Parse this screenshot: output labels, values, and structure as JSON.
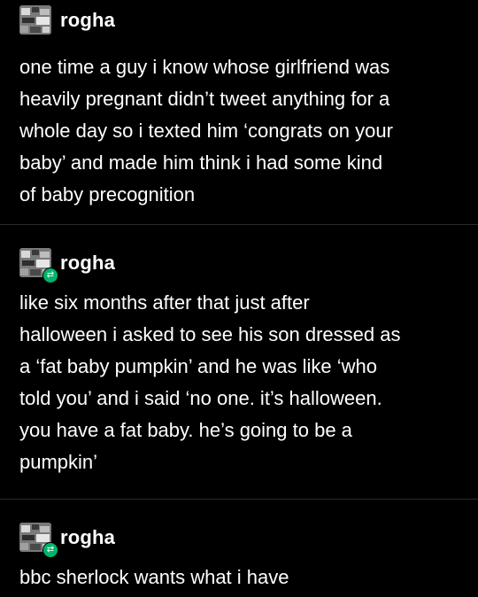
{
  "posts": [
    {
      "username": "rogha",
      "reblog": false,
      "text": "one time a guy i know whose girlfriend was\nheavily pregnant didn’t tweet anything for a\nwhole day so i texted him ‘congrats on your\nbaby’ and made him think i had some kind\nof baby precognition"
    },
    {
      "username": "rogha",
      "reblog": true,
      "text": "like six months after that just after\nhalloween i asked to see his son dressed as\na ‘fat baby pumpkin’ and he was like ‘who\ntold you’ and i said ‘no one. it’s halloween.\nyou have a fat baby. he’s going to be a\npumpkin’"
    },
    {
      "username": "rogha",
      "reblog": true,
      "text": "bbc sherlock wants what i have"
    }
  ],
  "colors": {
    "background": "#000000",
    "text": "#ffffff",
    "reblog_badge": "#00b36b",
    "divider": "#2b2b2b"
  },
  "icons": {
    "reblog": "reblog-icon"
  }
}
